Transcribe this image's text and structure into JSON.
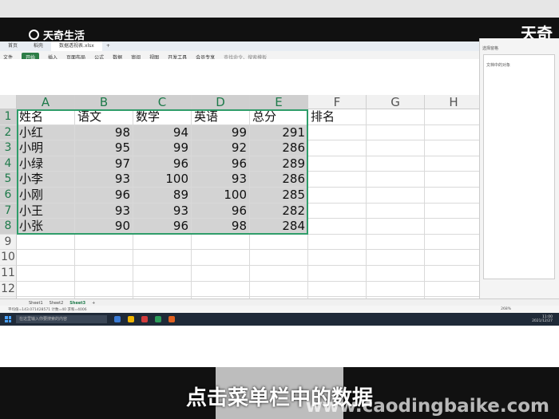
{
  "branding": {
    "logo_text": "天奇生活",
    "corner_text": "天奇",
    "watermark": "www.caodingbaike.com"
  },
  "caption": "点击菜单栏中的数据",
  "app": {
    "tabs": [
      {
        "label": "首页"
      },
      {
        "label": "稻壳"
      },
      {
        "label": "数据透视表.xlsx"
      },
      {
        "label": "+"
      }
    ],
    "menu": [
      "文件",
      "开始",
      "插入",
      "页面布局",
      "公式",
      "数据",
      "审阅",
      "视图",
      "开发工具",
      "会员专享"
    ],
    "search_placeholder": "查找命令、搜索模板",
    "name_box": "A1",
    "formula_fx": "fx",
    "formula_value": "姓名"
  },
  "grid": {
    "columns": [
      "A",
      "B",
      "C",
      "D",
      "E",
      "F",
      "G",
      "H"
    ],
    "rows": [
      "1",
      "2",
      "3",
      "4",
      "5",
      "6",
      "7",
      "8",
      "9",
      "10",
      "11",
      "12",
      "13",
      "14",
      "15"
    ],
    "header_row": [
      "姓名",
      "语文",
      "数学",
      "英语",
      "总分",
      "排名"
    ],
    "data": [
      [
        "小红",
        "98",
        "94",
        "99",
        "291"
      ],
      [
        "小明",
        "95",
        "99",
        "92",
        "286"
      ],
      [
        "小绿",
        "97",
        "96",
        "96",
        "289"
      ],
      [
        "小李",
        "93",
        "100",
        "93",
        "286"
      ],
      [
        "小刚",
        "96",
        "89",
        "100",
        "285"
      ],
      [
        "小王",
        "93",
        "93",
        "96",
        "282"
      ],
      [
        "小张",
        "90",
        "96",
        "98",
        "284"
      ]
    ]
  },
  "side_panel": {
    "title": "选择窗格",
    "subtitle": "文档中的对象"
  },
  "sheets": [
    {
      "label": "Sheet1"
    },
    {
      "label": "Sheet2"
    },
    {
      "label": "Sheet3"
    },
    {
      "label": "+"
    }
  ],
  "status": {
    "summary": "平均值=143.071428571 计数=40 求和=4006",
    "zoom": "268%"
  },
  "taskbar": {
    "search": "在这里输入你要搜索的内容",
    "time": "11:00",
    "date": "2021/12/27"
  }
}
